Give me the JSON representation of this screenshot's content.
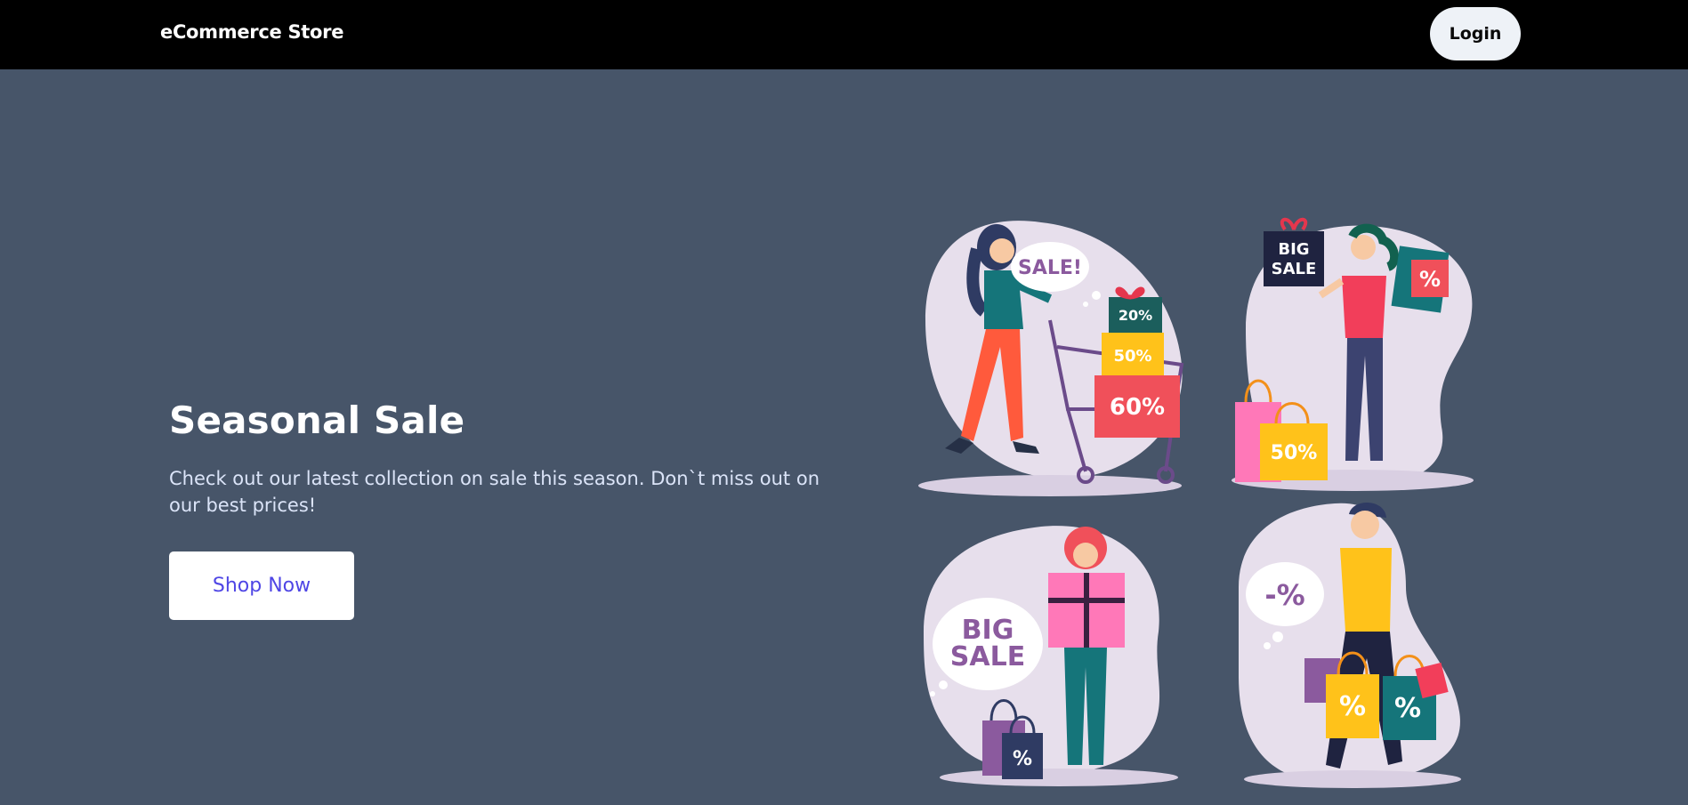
{
  "nav": {
    "brand": "eCommerce Store",
    "login_label": "Login"
  },
  "hero": {
    "title": "Seasonal Sale",
    "description": "Check out our latest collection on sale this season. Don`t miss out on our best prices!",
    "cta_label": "Shop Now"
  },
  "illustration": {
    "sale_bubble": "SALE!",
    "box_20": "20%",
    "box_50": "50%",
    "box_60": "60%",
    "sign_big": "BIG",
    "sign_sale": "SALE",
    "bag_percent": "%",
    "bag_50": "50%",
    "bubble_big": "BIG",
    "bubble_sale": "SALE",
    "bag_percent_2": "%",
    "bubble_minus": "-%",
    "bag_percent_3": "%",
    "bag_percent_4": "%"
  },
  "colors": {
    "navbar": "#000000",
    "background": "#475569",
    "accent": "#4f46e5",
    "blob": "#e7dfec"
  }
}
